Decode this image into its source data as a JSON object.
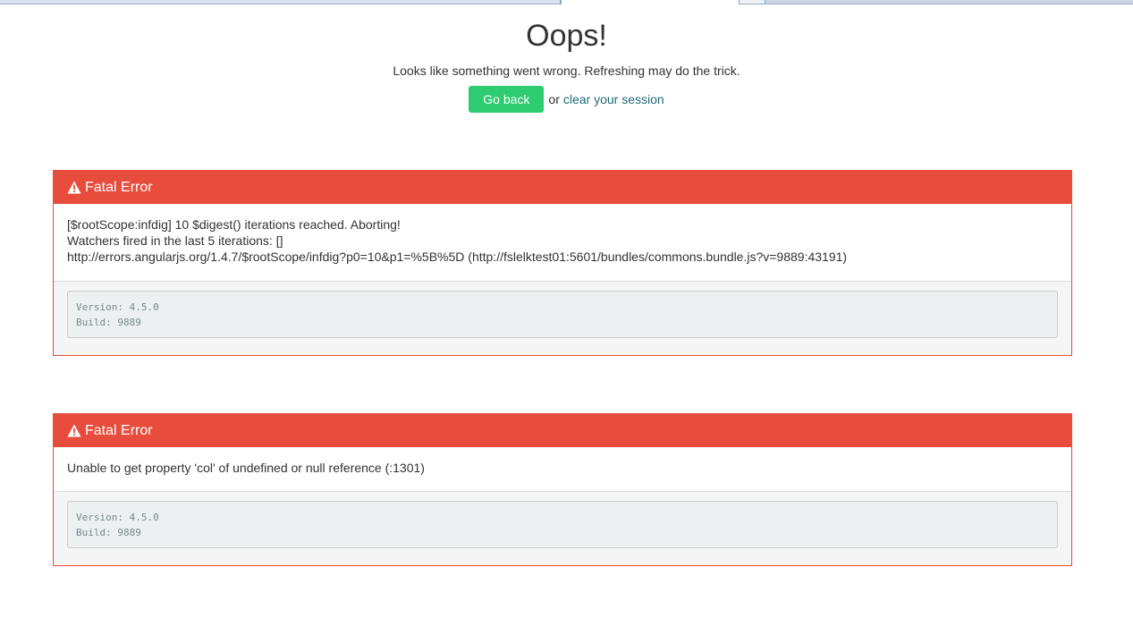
{
  "header": {
    "title": "Oops!",
    "subtitle": "Looks like something went wrong. Refreshing may do the trick.",
    "go_back_label": "Go back",
    "or_text": "or",
    "clear_session_label": "clear your session"
  },
  "errors": [
    {
      "heading": "Fatal Error",
      "icon": "warning-icon",
      "message_lines": [
        "[$rootScope:infdig] 10 $digest() iterations reached. Aborting!",
        "Watchers fired in the last 5 iterations: []",
        "http://errors.angularjs.org/1.4.7/$rootScope/infdig?p0=10&p1=%5B%5D (http://fslelktest01:5601/bundles/commons.bundle.js?v=9889:43191)"
      ],
      "version_line": "Version: 4.5.0",
      "build_line": "Build: 9889"
    },
    {
      "heading": "Fatal Error",
      "icon": "warning-icon",
      "message_lines": [
        "Unable to get property 'col' of undefined or null reference (:1301)"
      ],
      "version_line": "Version: 4.5.0",
      "build_line": "Build: 9889"
    }
  ],
  "colors": {
    "danger": "#e74c3c",
    "success": "#2ecc71",
    "link": "#1f6b75"
  }
}
